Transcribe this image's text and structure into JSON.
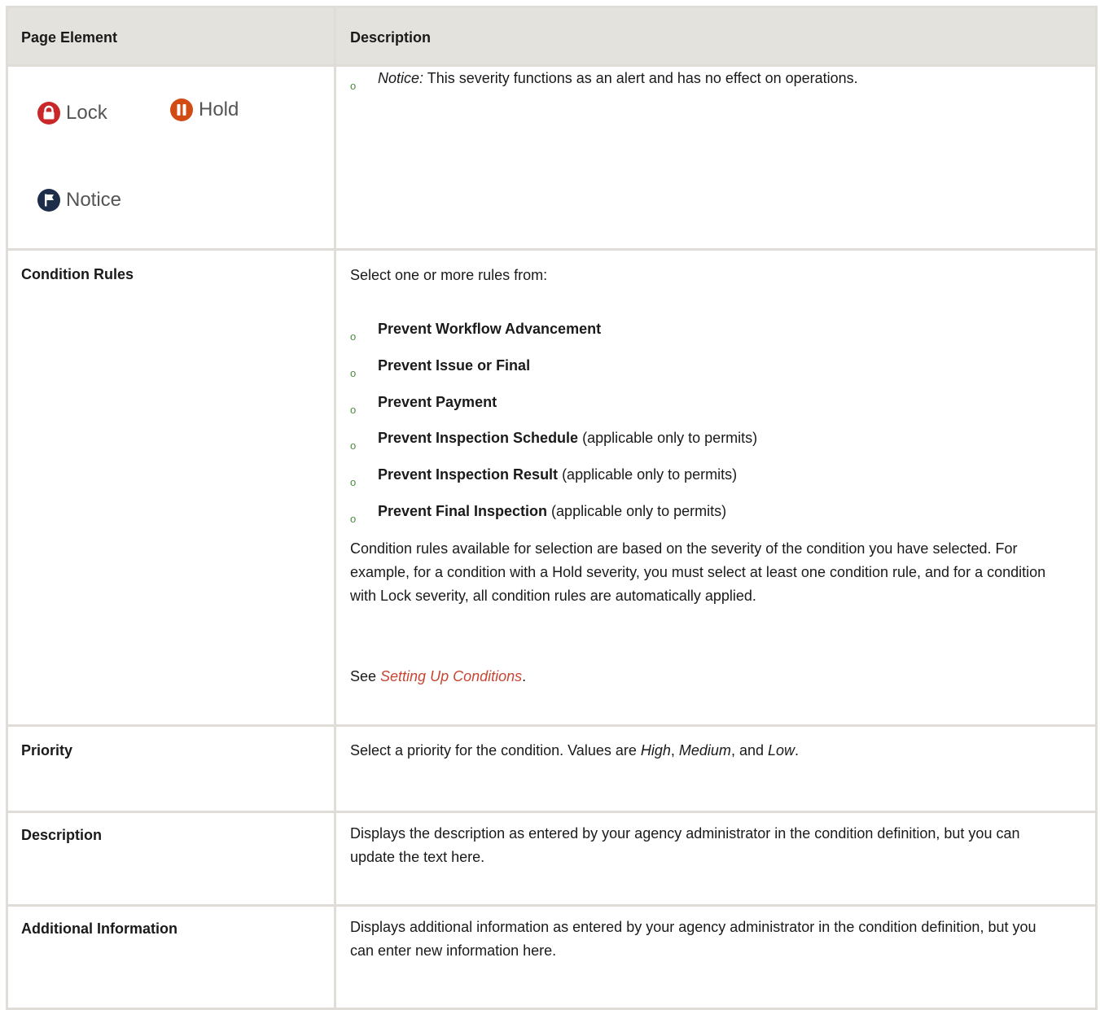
{
  "header": {
    "col1": "Page Element",
    "col2": "Description"
  },
  "severity_row": {
    "bullet_term": "Notice:",
    "bullet_text": " This severity functions as an alert and has no effect on operations.",
    "icons": [
      {
        "label": "Lock",
        "icon": "lock-icon",
        "color": "#c8282a"
      },
      {
        "label": "Hold",
        "icon": "pause-icon",
        "color": "#d24a14"
      },
      {
        "label": "Notice",
        "icon": "flag-icon",
        "color": "#1e2e4a"
      }
    ]
  },
  "condition_rules": {
    "label": "Condition Rules",
    "intro": "Select one or more rules from:",
    "rules": [
      {
        "name": "Prevent Workflow Advancement",
        "note": ""
      },
      {
        "name": "Prevent Issue or Final",
        "note": ""
      },
      {
        "name": "Prevent Payment",
        "note": ""
      },
      {
        "name": "Prevent Inspection Schedule",
        "note": " (applicable only to permits)"
      },
      {
        "name": "Prevent Inspection Result",
        "note": " (applicable only to permits)"
      },
      {
        "name": "Prevent Final Inspection",
        "note": " (applicable only to permits)"
      }
    ],
    "paragraph": "Condition rules available for selection are based on the severity of the condition you have selected. For example, for a condition with a Hold severity, you must select at least one condition rule, and for a condition with Lock severity, all condition rules are automatically applied.",
    "see_prefix": "See ",
    "see_link": "Setting Up Conditions",
    "see_suffix": "."
  },
  "priority": {
    "label": "Priority",
    "text_a": "Select a priority for the condition. Values are ",
    "high": "High",
    "sep1": ", ",
    "medium": "Medium",
    "sep2": ", and ",
    "low": "Low",
    "end": "."
  },
  "description": {
    "label": "Description",
    "text": "Displays the description as entered by your agency administrator in the condition definition, but you can update the text here."
  },
  "additional": {
    "label": "Additional Information",
    "text": "Displays additional information as entered by your agency administrator in the condition definition, but you can enter new information here."
  }
}
